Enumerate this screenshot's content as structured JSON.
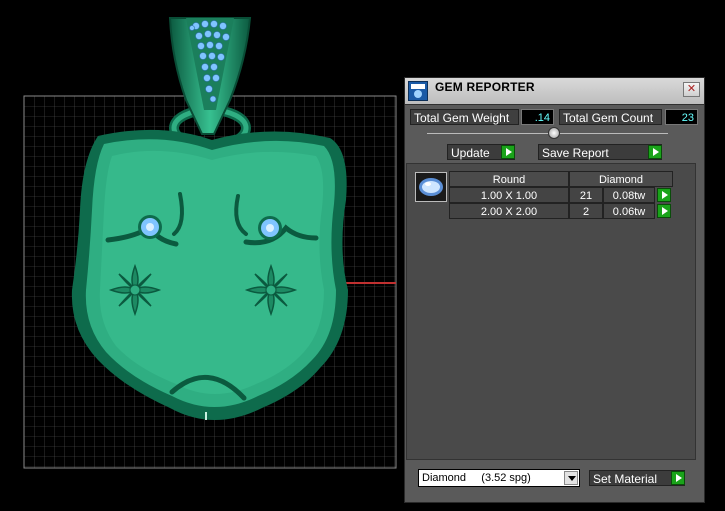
{
  "panel": {
    "title": "GEM REPORTER",
    "close_symbol": "✕",
    "total_weight_label": "Total Gem Weight",
    "total_weight_value": ".14",
    "total_count_label": "Total Gem Count",
    "total_count_value": "23",
    "update_label": "Update",
    "save_report_label": "Save Report",
    "table": {
      "col_shape": "Round",
      "col_material": "Diamond",
      "rows": [
        {
          "size": "1.00 X 1.00",
          "count": "21",
          "weight": "0.08tw"
        },
        {
          "size": "2.00 X 2.00",
          "count": "2",
          "weight": "0.06tw"
        }
      ]
    },
    "material_select": "Diamond     (3.52 spg)",
    "set_material_label": "Set Material"
  },
  "icons": {
    "app": "gem-reporter-app-icon",
    "close": "close-icon",
    "arrow": "play-arrow-icon",
    "gem": "gem-thumbnail-icon",
    "dropdown": "chevron-down-icon"
  },
  "colors": {
    "model": "#2fae82",
    "model_dark": "#0e6b4c",
    "gems": "#7fc4ff",
    "accent_value": "#66ffff",
    "arrow": "#1aa31a",
    "axis": "#c03030"
  }
}
